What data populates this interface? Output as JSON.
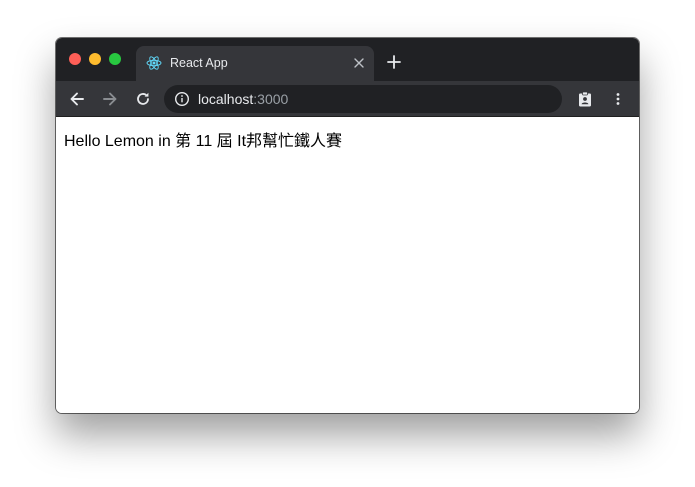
{
  "window": {
    "traffic_lights": {
      "close": "#fe5f57",
      "minimize": "#febc2e",
      "zoom": "#28c840"
    }
  },
  "tab": {
    "title": "React App",
    "favicon_icon": "react-logo-icon",
    "close_icon": "close-icon"
  },
  "new_tab_icon": "plus-icon",
  "toolbar": {
    "back_icon": "arrow-left-icon",
    "forward_icon": "arrow-right-icon",
    "reload_icon": "reload-icon",
    "info_icon": "info-icon",
    "url_host": "localhost",
    "url_port": ":3000",
    "translate_icon": "translate-icon",
    "profile_icon": "clipboard-profile-icon",
    "menu_icon": "more-vertical-icon"
  },
  "page": {
    "text": "Hello Lemon in 第 11 屆 It邦幫忙鐵人賽"
  },
  "colors": {
    "titlebar": "#202124",
    "toolbar": "#35363a",
    "react_accent": "#61dafb"
  }
}
